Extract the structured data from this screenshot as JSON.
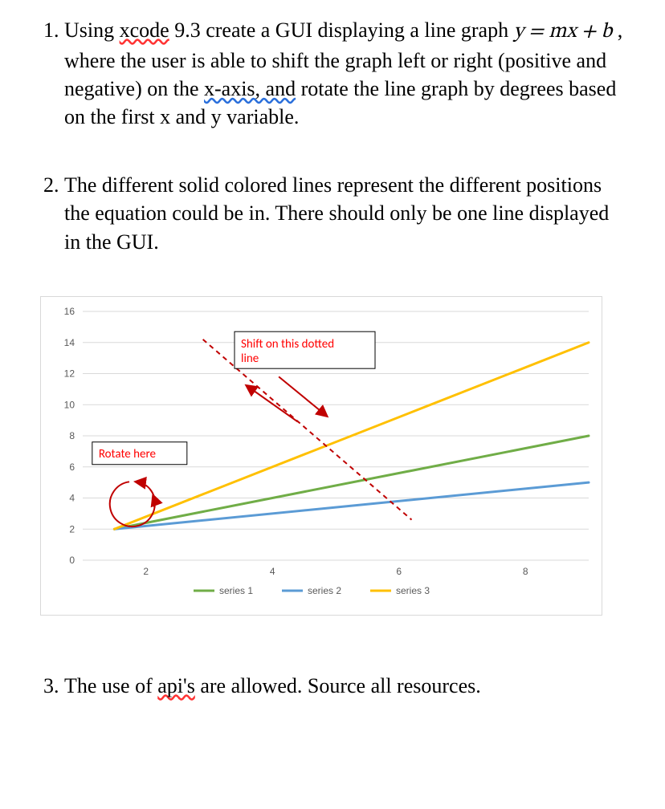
{
  "items": {
    "item1_parts": {
      "p1": "Using ",
      "xcode": "xcode",
      "p2": " 9.3 create a GUI displaying a line graph ",
      "equation": "y = mx + b",
      "p3": " , where the user is able to shift the graph left or right (positive and negative) on the ",
      "xaxis": "x-axis, and",
      "p4": " rotate the line graph by degrees based on the first x and y variable."
    },
    "item2": "The different solid colored lines represent the different positions the equation could be in. There should only be one line displayed in the GUI.",
    "item3_parts": {
      "p1": "The use of ",
      "apis": "api's",
      "p2": " are allowed. Source all resources."
    }
  },
  "annotations": {
    "rotate": "Rotate here",
    "shift_l1": "Shift on this dotted",
    "shift_l2": "line"
  },
  "chart_data": {
    "type": "line",
    "title": "",
    "xlabel": "",
    "ylabel": "",
    "x_ticks": [
      2,
      4,
      6,
      8
    ],
    "y_ticks": [
      0,
      2,
      4,
      6,
      8,
      10,
      12,
      14,
      16
    ],
    "xlim": [
      1,
      9
    ],
    "ylim": [
      0,
      16
    ],
    "series": [
      {
        "name": "series 1",
        "color": "#70AD47",
        "x": [
          1.5,
          9
        ],
        "y": [
          2,
          8
        ]
      },
      {
        "name": "series 2",
        "color": "#5B9BD5",
        "x": [
          1.5,
          9
        ],
        "y": [
          2,
          5
        ]
      },
      {
        "name": "series 3",
        "color": "#FFC000",
        "x": [
          1.5,
          9
        ],
        "y": [
          2,
          14
        ]
      }
    ],
    "dotted_line": {
      "color": "#C00000",
      "x": [
        2.9,
        6.2
      ],
      "y": [
        14.2,
        2.6
      ]
    },
    "legend": [
      "series 1",
      "series 2",
      "series 3"
    ]
  }
}
